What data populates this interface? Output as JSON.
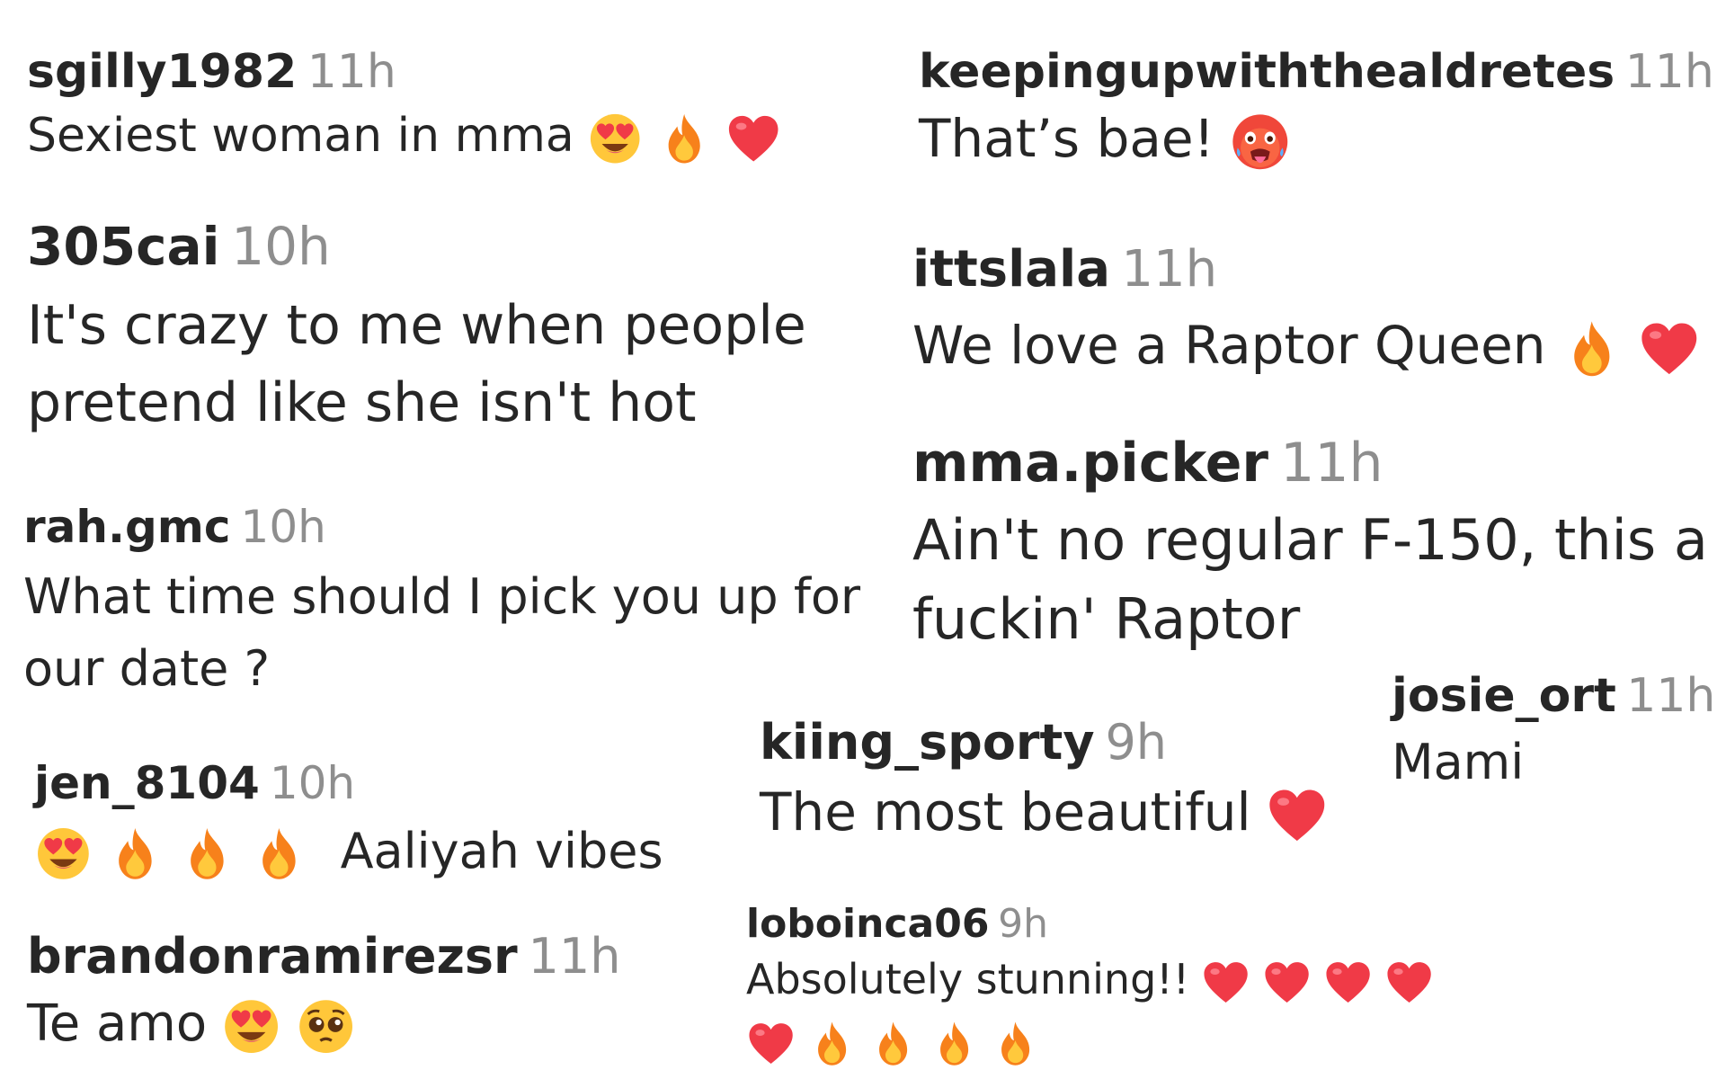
{
  "comments": [
    {
      "username": "sgilly1982",
      "time": "11h",
      "text": "Sexiest woman in mma",
      "emojis": [
        "heart-eyes",
        "fire",
        "red-heart"
      ]
    },
    {
      "username": "305cai",
      "time": "10h",
      "text": "It's crazy to me when people pretend like she isn't hot",
      "emojis": []
    },
    {
      "username": "rah.gmc",
      "time": "10h",
      "text": "What time should I pick you up for our date ?",
      "emojis": []
    },
    {
      "username": "jen_8104",
      "time": "10h",
      "text": "Aaliyah vibes",
      "emojis": [
        "heart-eyes",
        "fire",
        "fire",
        "fire"
      ]
    },
    {
      "username": "brandonramirezsr",
      "time": "11h",
      "text": "Te amo",
      "emojis": [
        "heart-eyes",
        "pleading-face"
      ]
    },
    {
      "username": "keepingupwiththealdretes",
      "time": "11h",
      "text": "That’s bae!",
      "emojis": [
        "hot-face"
      ]
    },
    {
      "username": "ittslala",
      "time": "11h",
      "text": "We love a Raptor Queen",
      "emojis": [
        "fire",
        "red-heart"
      ]
    },
    {
      "username": "mma.picker",
      "time": "11h",
      "text": "Ain't no regular F-150, this a fuckin' Raptor",
      "emojis": []
    },
    {
      "username": "josie_ort",
      "time": "11h",
      "text": "Mami",
      "emojis": []
    },
    {
      "username": "kiing_sporty",
      "time": "9h",
      "text": "The most beautiful",
      "emojis": [
        "red-heart"
      ]
    },
    {
      "username": "loboinca06",
      "time": "9h",
      "text": "Absolutely stunning!!",
      "emojis": [
        "red-heart",
        "red-heart",
        "red-heart",
        "red-heart"
      ],
      "emojis_line2": [
        "red-heart",
        "fire",
        "fire",
        "fire",
        "fire"
      ]
    }
  ]
}
